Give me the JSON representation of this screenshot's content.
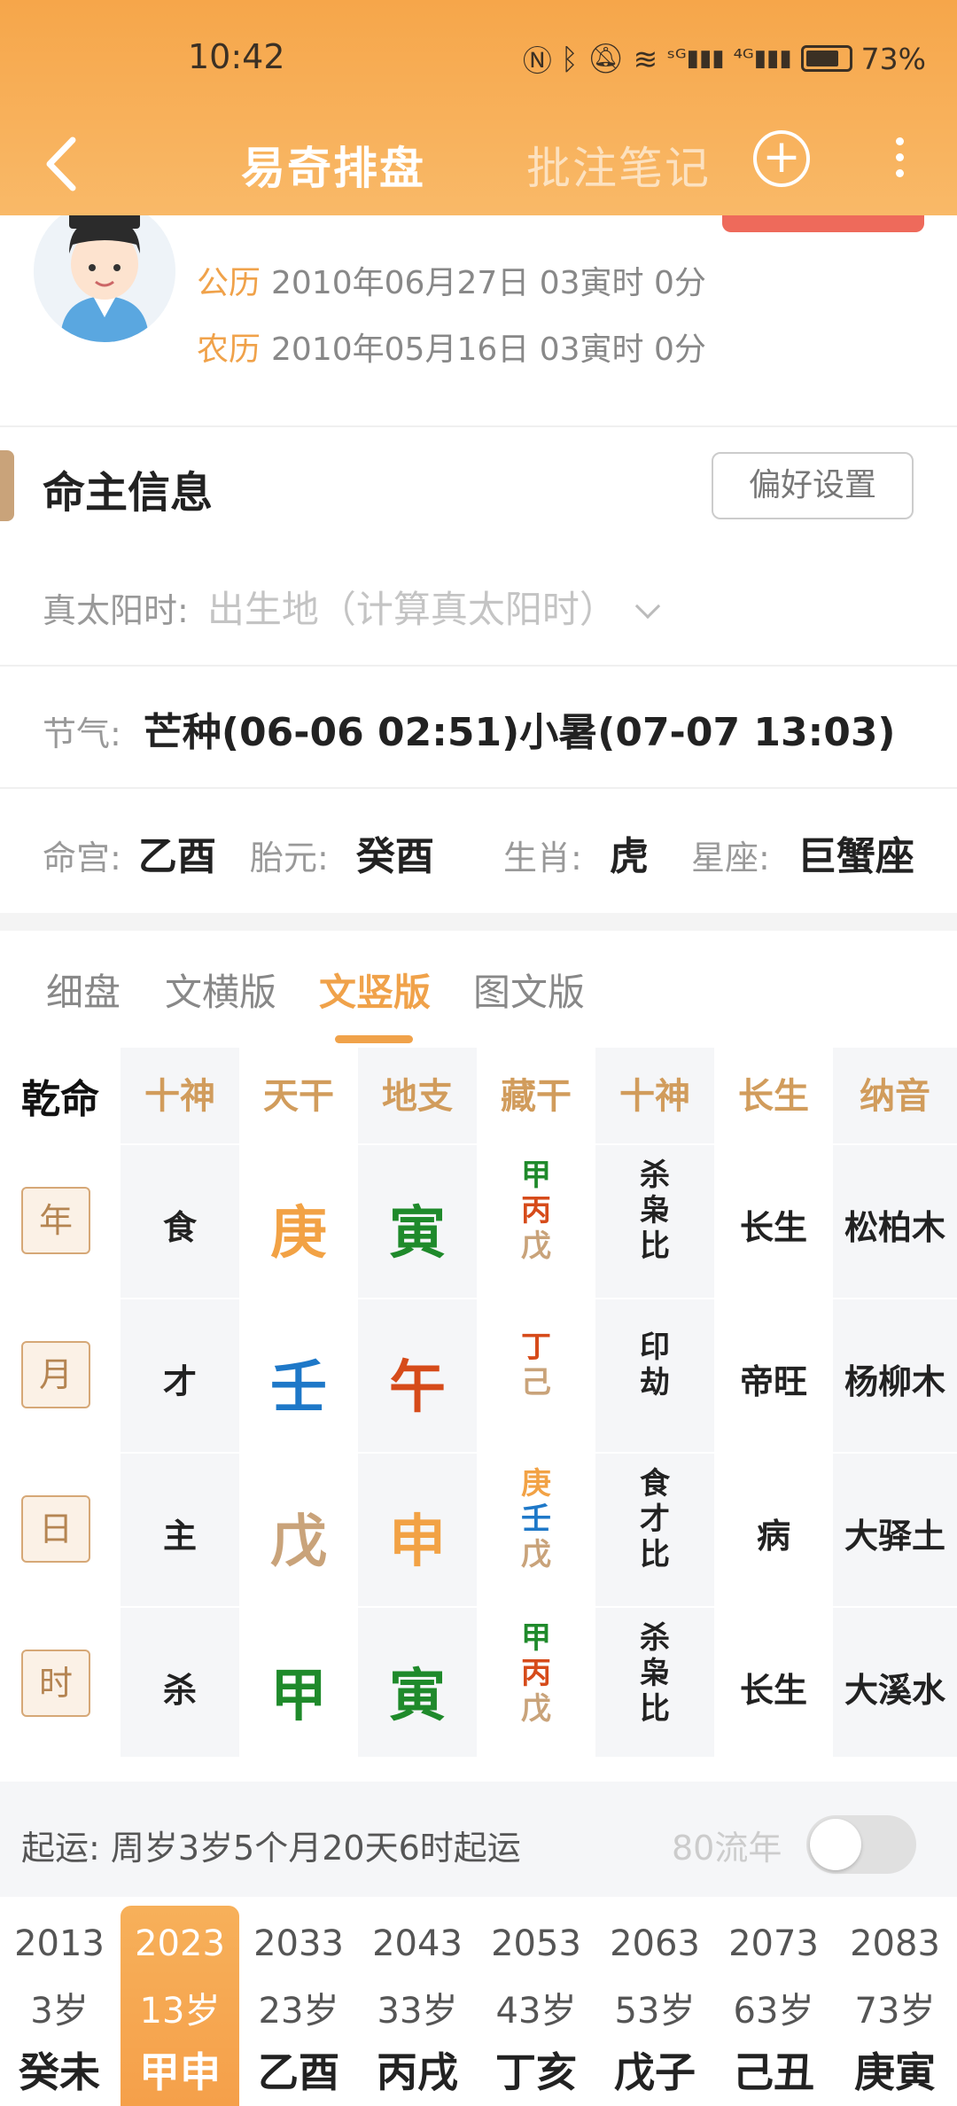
{
  "status_bar": {
    "time": "10:42",
    "battery": "73%"
  },
  "nav": {
    "title": "易奇排盘",
    "notes": "批注笔记"
  },
  "profile": {
    "solar_label": "公历",
    "solar_date": "2010年06月27日 03寅时 0分",
    "lunar_label": "农历",
    "lunar_date": "2010年05月16日 03寅时 0分"
  },
  "info": {
    "section_title": "命主信息",
    "pref_button": "偏好设置",
    "true_solar_label": "真太阳时:",
    "true_solar_placeholder": "出生地（计算真太阳时）",
    "solar_term_label": "节气:",
    "solar_term_value": "芒种(06-06 02:51)小暑(07-07 13:03)",
    "minggong_label": "命宫:",
    "minggong_value": "乙酉",
    "taiyuan_label": "胎元:",
    "taiyuan_value": "癸酉",
    "shengxiao_label": "生肖:",
    "shengxiao_value": "虎",
    "xingzuo_label": "星座:",
    "xingzuo_value": "巨蟹座"
  },
  "tabs": [
    "细盘",
    "文横版",
    "文竖版",
    "图文版"
  ],
  "grid": {
    "corner": "乾命",
    "headers": [
      "十神",
      "天干",
      "地支",
      "藏干",
      "十神",
      "长生",
      "纳音"
    ],
    "rows": [
      {
        "pillar": "年",
        "shishen": "食",
        "gan": "庚",
        "zhi": "寅",
        "canggan": [
          "甲",
          "丙",
          "戊"
        ],
        "shishen2": [
          "杀",
          "枭",
          "比"
        ],
        "changsheng": "长生",
        "nayin": "松柏木"
      },
      {
        "pillar": "月",
        "shishen": "才",
        "gan": "壬",
        "zhi": "午",
        "canggan": [
          "丁",
          "己"
        ],
        "shishen2": [
          "印",
          "劫"
        ],
        "changsheng": "帝旺",
        "nayin": "杨柳木"
      },
      {
        "pillar": "日",
        "shishen": "主",
        "gan": "戊",
        "zhi": "申",
        "canggan": [
          "庚",
          "壬",
          "戊"
        ],
        "shishen2": [
          "食",
          "才",
          "比"
        ],
        "changsheng": "病",
        "nayin": "大驿土"
      },
      {
        "pillar": "时",
        "shishen": "杀",
        "gan": "甲",
        "zhi": "寅",
        "canggan": [
          "甲",
          "丙",
          "戊"
        ],
        "shishen2": [
          "杀",
          "枭",
          "比"
        ],
        "changsheng": "长生",
        "nayin": "大溪水"
      }
    ]
  },
  "luck": {
    "start_text": "起运:  周岁3岁5个月20天6时起运",
    "liunian_label": "80流年",
    "columns": [
      {
        "year": "2013",
        "age": "3岁",
        "gz": "癸未"
      },
      {
        "year": "2023",
        "age": "13岁",
        "gz": "甲申"
      },
      {
        "year": "2033",
        "age": "23岁",
        "gz": "乙酉"
      },
      {
        "year": "2043",
        "age": "33岁",
        "gz": "丙戌"
      },
      {
        "year": "2053",
        "age": "43岁",
        "gz": "丁亥"
      },
      {
        "year": "2063",
        "age": "53岁",
        "gz": "戊子"
      },
      {
        "year": "2073",
        "age": "63岁",
        "gz": "己丑"
      },
      {
        "year": "2083",
        "age": "73岁",
        "gz": "庚寅"
      }
    ]
  }
}
